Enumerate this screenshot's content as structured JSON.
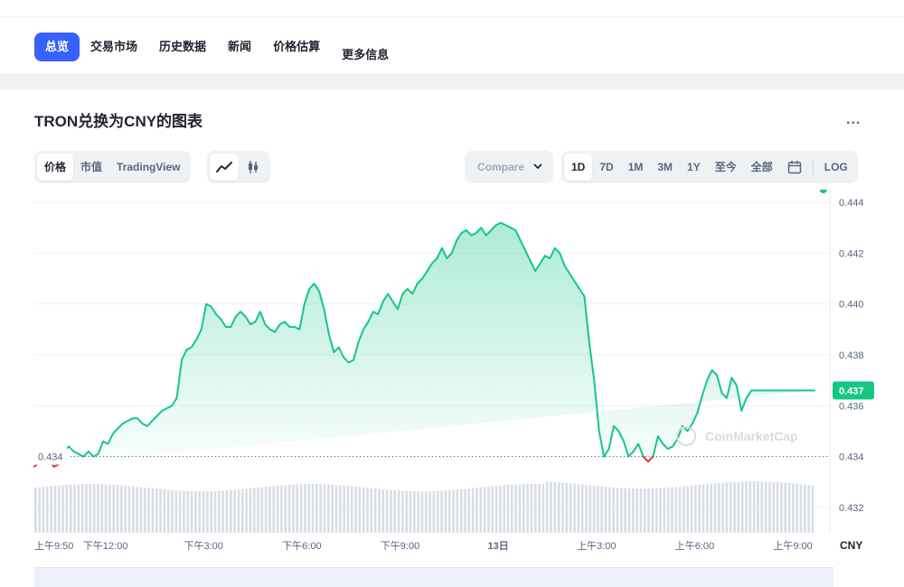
{
  "nav": {
    "tabs": [
      "总览",
      "交易市场",
      "历史数据",
      "新闻",
      "价格估算",
      "更多信息"
    ],
    "active": 0
  },
  "chart_header": {
    "title": "TRON兑换为CNY的图表",
    "more_label": "...",
    "type_tabs": [
      "价格",
      "市值",
      "TradingView"
    ],
    "type_active": 0,
    "view_icons": [
      "line-chart-icon",
      "candlestick-icon"
    ],
    "compare_label": "Compare",
    "ranges": [
      "1D",
      "7D",
      "1M",
      "3M",
      "1Y",
      "至今",
      "全部"
    ],
    "range_active": 0,
    "calendar_icon": "calendar-icon",
    "log_label": "LOG"
  },
  "colors": {
    "accent": "#3861fb",
    "up": "#16c784",
    "down": "#ea3943",
    "text": "#222531",
    "muted": "#58667e"
  },
  "chart_data": {
    "type": "area",
    "currency": "CNY",
    "watermark": "CoinMarketCap",
    "ylim": [
      0.431,
      0.4445
    ],
    "y_ticks": [
      "0.444",
      "0.442",
      "0.440",
      "0.438",
      "0.436",
      "0.434",
      "0.432"
    ],
    "open_price": 0.434,
    "open_label": "0.434",
    "current_price": 0.4366,
    "current_label": "0.437",
    "x_labels": [
      "上午9:50",
      "下午12:00",
      "下午3:00",
      "下午6:00",
      "下午9:00",
      "13日",
      "上午3:00",
      "上午6:00",
      "上午9:00"
    ],
    "x_label_hours": [
      0,
      2.17,
      5.17,
      8.17,
      11.17,
      14.17,
      17.17,
      20.17,
      23.17
    ],
    "x_range_hours": [
      0,
      24.3
    ],
    "series": [
      {
        "hours": [
          0,
          0.15,
          0.3,
          0.45,
          0.6,
          0.75,
          0.9,
          1.05,
          1.2,
          1.35,
          1.5,
          1.65,
          1.8,
          1.95,
          2.1,
          2.25,
          2.4,
          2.55,
          2.7,
          2.85,
          3.0,
          3.15,
          3.3,
          3.45,
          3.6,
          3.75,
          3.9,
          4.05,
          4.2,
          4.35,
          4.5,
          4.65,
          4.8,
          4.95,
          5.1,
          5.25,
          5.4,
          5.55,
          5.7,
          5.85,
          6.0,
          6.15,
          6.3,
          6.45,
          6.6,
          6.75,
          6.9,
          7.05,
          7.2,
          7.35,
          7.5,
          7.65,
          7.8,
          7.95,
          8.1,
          8.25,
          8.4,
          8.55,
          8.7,
          8.85,
          9.0,
          9.15,
          9.3,
          9.45,
          9.6,
          9.75,
          9.9,
          10.05,
          10.2,
          10.35,
          10.5,
          10.65,
          10.8,
          10.95,
          11.1,
          11.25,
          11.4,
          11.55,
          11.7,
          11.85,
          12.0,
          12.15,
          12.3,
          12.45,
          12.6,
          12.75,
          12.9,
          13.05,
          13.2,
          13.35,
          13.5,
          13.65,
          13.8,
          13.95,
          14.1,
          14.25,
          14.4,
          14.55,
          14.7,
          14.85,
          15.0,
          15.15,
          15.3,
          15.45,
          15.6,
          15.75,
          15.9,
          16.05,
          16.2,
          16.35,
          16.5,
          16.65,
          16.8,
          16.95,
          17.1,
          17.25,
          17.4,
          17.55,
          17.7,
          17.85,
          18.0,
          18.15,
          18.3,
          18.45,
          18.6,
          18.75,
          18.9,
          19.05,
          19.2,
          19.35,
          19.5,
          19.65,
          19.8,
          19.95,
          20.1,
          20.25,
          20.4,
          20.55,
          20.7,
          20.85,
          21.0,
          21.15,
          21.3,
          21.45,
          21.6,
          21.75,
          21.9,
          22.05,
          22.2,
          22.35,
          22.5,
          22.65,
          22.8,
          22.95,
          23.1,
          23.25,
          23.4,
          23.55,
          23.7,
          23.85,
          24.0,
          24.1
        ],
        "values": [
          0.4336,
          0.4338,
          0.4342,
          0.4339,
          0.4336,
          0.4337,
          0.4341,
          0.4344,
          0.4342,
          0.4341,
          0.434,
          0.4342,
          0.434,
          0.4341,
          0.4346,
          0.4345,
          0.4349,
          0.4351,
          0.4353,
          0.4354,
          0.4355,
          0.4355,
          0.4353,
          0.4352,
          0.4354,
          0.4356,
          0.4358,
          0.4359,
          0.436,
          0.4363,
          0.4378,
          0.4382,
          0.4383,
          0.4386,
          0.439,
          0.44,
          0.4399,
          0.4396,
          0.4394,
          0.4391,
          0.4391,
          0.4395,
          0.4397,
          0.4395,
          0.4392,
          0.4393,
          0.4397,
          0.4392,
          0.439,
          0.4389,
          0.4392,
          0.4393,
          0.4391,
          0.4391,
          0.439,
          0.44,
          0.4406,
          0.4408,
          0.4405,
          0.4398,
          0.4388,
          0.4381,
          0.4383,
          0.4379,
          0.4377,
          0.4378,
          0.4385,
          0.439,
          0.4393,
          0.4397,
          0.4396,
          0.4401,
          0.4404,
          0.4401,
          0.4398,
          0.4404,
          0.4406,
          0.4404,
          0.4408,
          0.441,
          0.4413,
          0.4416,
          0.4418,
          0.4422,
          0.4418,
          0.442,
          0.4425,
          0.4428,
          0.4429,
          0.4427,
          0.4428,
          0.443,
          0.4427,
          0.4429,
          0.4431,
          0.4432,
          0.4431,
          0.443,
          0.4429,
          0.4425,
          0.4421,
          0.4417,
          0.4413,
          0.4416,
          0.4419,
          0.4418,
          0.4422,
          0.442,
          0.4415,
          0.4412,
          0.4409,
          0.4406,
          0.4403,
          0.4385,
          0.437,
          0.435,
          0.434,
          0.4343,
          0.4352,
          0.435,
          0.4346,
          0.434,
          0.4342,
          0.4345,
          0.434,
          0.4338,
          0.434,
          0.4348,
          0.4345,
          0.4343,
          0.4344,
          0.4347,
          0.4352,
          0.435,
          0.4353,
          0.4357,
          0.4364,
          0.437,
          0.4374,
          0.4372,
          0.4365,
          0.4363,
          0.4371,
          0.4368,
          0.4358,
          0.4363,
          0.4366,
          0.4366,
          0.4366,
          0.4366,
          0.4366,
          0.4366,
          0.4366,
          0.4366,
          0.4366,
          0.4366,
          0.4366,
          0.4366,
          0.4366,
          0.4366
        ]
      }
    ]
  }
}
